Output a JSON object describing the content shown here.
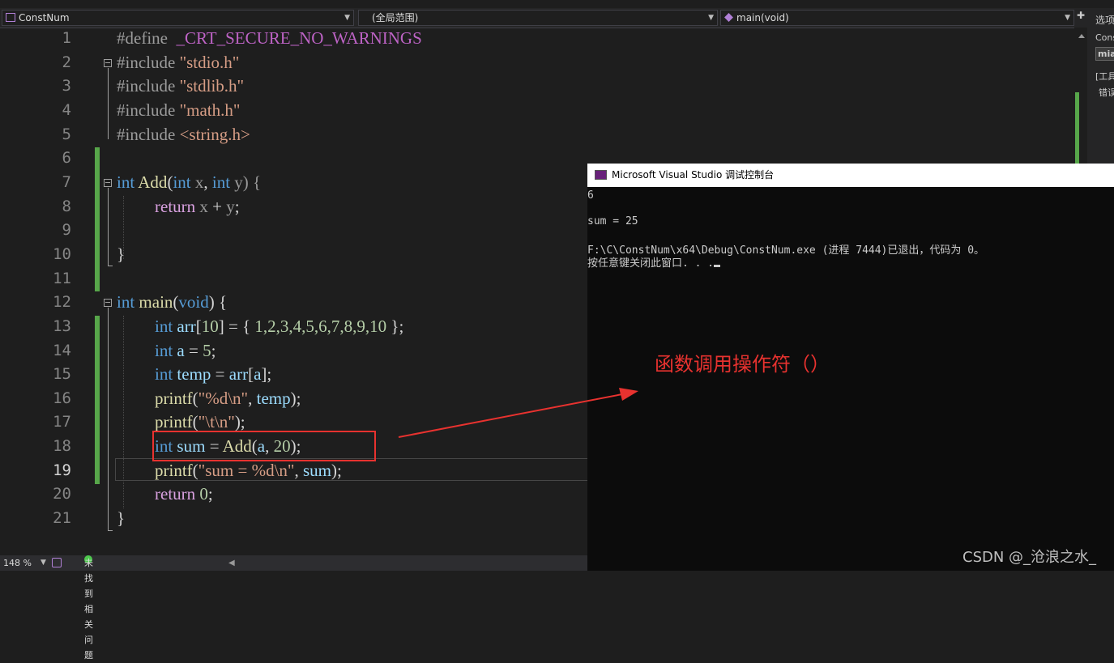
{
  "nav": {
    "project": "ConstNum",
    "scope": "(全局范围)",
    "function": "main(void)"
  },
  "right_panel": {
    "tab": "选项",
    "line1": "Cons",
    "line2": "mia",
    "line3": "[工具",
    "line4": "错误"
  },
  "editor": {
    "line_numbers": [
      "1",
      "2",
      "3",
      "4",
      "5",
      "6",
      "7",
      "8",
      "9",
      "10",
      "11",
      "12",
      "13",
      "14",
      "15",
      "16",
      "17",
      "18",
      "19",
      "20",
      "21"
    ],
    "current_line": "19",
    "lines": {
      "l1_a": "#define",
      "l1_b": "_CRT_SECURE_NO_WARNINGS",
      "l2_a": "#include",
      "l2_b": "\"stdio.h\"",
      "l3_a": "#include",
      "l3_b": "\"stdlib.h\"",
      "l4_a": "#include",
      "l4_b": "\"math.h\"",
      "l5_a": "#include",
      "l5_b": "<string.h>",
      "l7_a": "int",
      "l7_b": "Add",
      "l7_c": "(",
      "l7_d": "int",
      "l7_e": "x",
      "l7_f": ", ",
      "l7_g": "int",
      "l7_h": "y",
      "l7_i": ") {",
      "l8_a": "return",
      "l8_b": "x",
      "l8_c": "+",
      "l8_d": "y",
      "l8_e": ";",
      "l10": "}",
      "l12_a": "int",
      "l12_b": "main",
      "l12_c": "(",
      "l12_d": "void",
      "l12_e": ") {",
      "l13_a": "int",
      "l13_b": "arr",
      "l13_c": "[",
      "l13_d": "10",
      "l13_e": "] = { ",
      "l13_f": "1,2,3,4,5,6,7,8,9,10",
      "l13_g": " };",
      "l14_a": "int",
      "l14_b": "a",
      "l14_c": " = ",
      "l14_d": "5",
      "l14_e": ";",
      "l15_a": "int",
      "l15_b": "temp",
      "l15_c": " = ",
      "l15_d": "arr",
      "l15_e": "[",
      "l15_f": "a",
      "l15_g": "];",
      "l16_a": "printf",
      "l16_b": "(",
      "l16_c": "\"%d\\n\"",
      "l16_d": ", ",
      "l16_e": "temp",
      "l16_f": ");",
      "l17_a": "printf",
      "l17_b": "(",
      "l17_c": "\"\\t\\n\"",
      "l17_d": ");",
      "l18_a": "int",
      "l18_b": "sum",
      "l18_c": " = ",
      "l18_d": "Add",
      "l18_e": "(",
      "l18_f": "a",
      "l18_g": ", ",
      "l18_h": "20",
      "l18_i": ");",
      "l19_a": "printf",
      "l19_b": "(",
      "l19_c": "\"sum = %d\\n\"",
      "l19_d": ", ",
      "l19_e": "sum",
      "l19_f": ");",
      "l20_a": "return",
      "l20_b": "0",
      "l20_c": ";",
      "l21": "}"
    }
  },
  "console": {
    "title": "Microsoft Visual Studio 调试控制台",
    "output": [
      "6",
      "",
      "sum = 25",
      "",
      "F:\\C\\ConstNum\\x64\\Debug\\ConstNum.exe (进程 7444)已退出，代码为 0。",
      "按任意键关闭此窗口. . ."
    ]
  },
  "annotation": {
    "label": "函数调用操作符（）",
    "color": "#e8322f"
  },
  "status": {
    "zoom": "148 %",
    "issues": "未找到相关问题"
  },
  "watermark": "CSDN @_沧浪之水_"
}
